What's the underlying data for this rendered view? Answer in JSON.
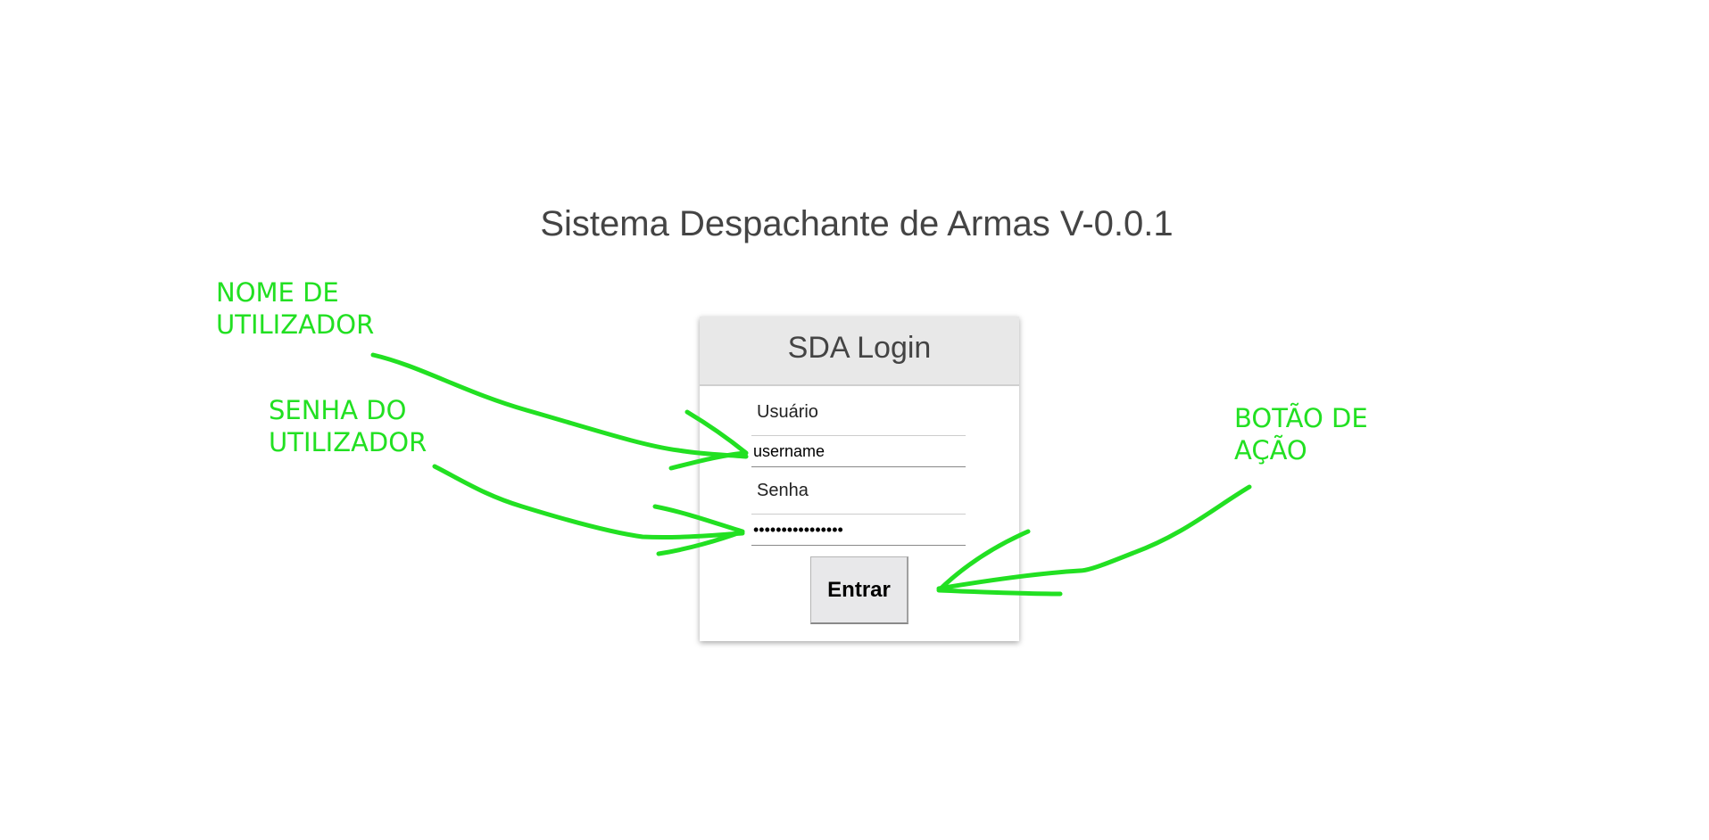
{
  "page": {
    "title": "Sistema Despachante de Armas V-0.0.1"
  },
  "login": {
    "header": "SDA Login",
    "username_label": "Usuário",
    "username_value": "username",
    "password_label": "Senha",
    "password_value": "••••••••••••••••",
    "submit_label": "Entrar"
  },
  "annotations": {
    "username_note": "NOME DE\nUTILIZADOR",
    "password_note": "SENHA DO\nUTILIZADOR",
    "action_note": "BOTÃO DE\nAÇÃO",
    "color": "#22e022"
  },
  "colors": {
    "title_text": "#444444",
    "header_bg": "#e8e8e8",
    "button_bg": "#e8e8ea"
  }
}
